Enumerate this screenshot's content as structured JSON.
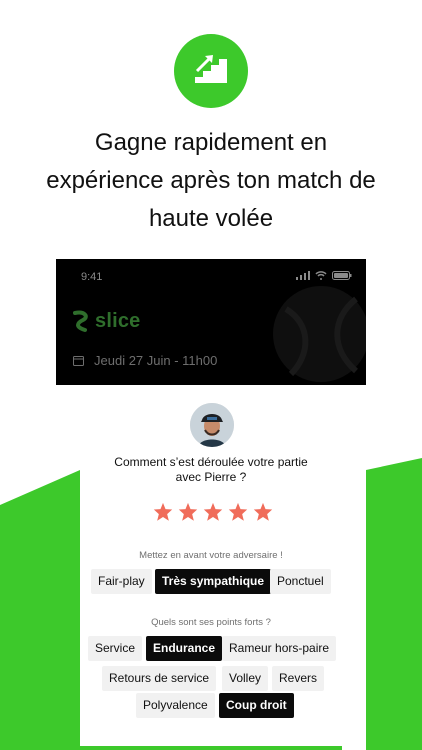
{
  "colors": {
    "green": "#3dc92b",
    "star": "#f06c5a",
    "chip_active": "#0b0b0b"
  },
  "hero": {
    "icon": "stairs-up-icon",
    "headline_line1": "Gagne rapidement en",
    "headline_line2": "expérience après ton match de",
    "headline_line3": "haute volée"
  },
  "phone": {
    "status_time": "9:41",
    "logo_text": "slice",
    "date": "Jeudi 27 Juin - 11h00"
  },
  "rating": {
    "question_line1": "Comment s’est déroulée votre partie",
    "question_line2": "avec Pierre ?",
    "stars": 5,
    "highlight_label": "Mettez en avant votre adversaire !",
    "highlight_chips": [
      "Fair-play",
      "Très sympathique",
      "Ponctuel"
    ],
    "strengths_label": "Quels sont ses points forts ?",
    "strengths_chips": [
      "Service",
      "Endurance",
      "Rameur hors-paire",
      "Retours de service",
      "Volley",
      "Revers",
      "Polyvalence",
      "Coup droit"
    ]
  }
}
